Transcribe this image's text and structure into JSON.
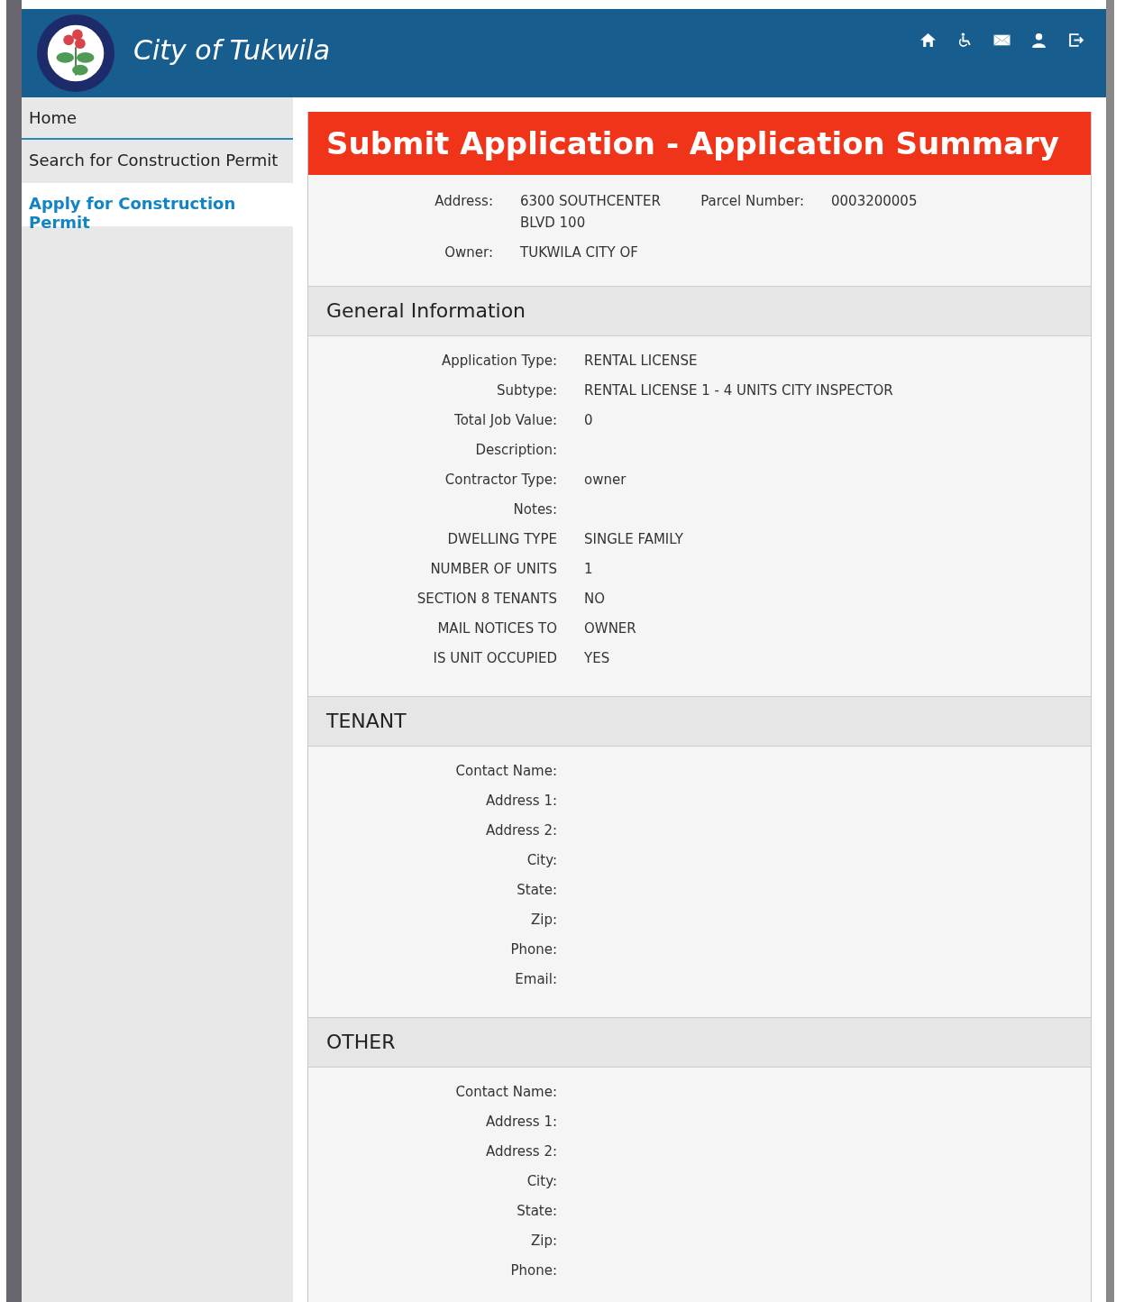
{
  "header": {
    "title": "City of Tukwila"
  },
  "sidebar": {
    "items": [
      {
        "label": "Home",
        "selected": false
      },
      {
        "label": "Search for Construction Permit",
        "selected": false
      },
      {
        "label": "Apply for Construction Permit",
        "selected": true
      }
    ]
  },
  "page_title": "Submit Application - Application Summary",
  "summary": {
    "address_label": "Address:",
    "address": "6300 SOUTHCENTER BLVD 100",
    "parcel_label": "Parcel Number:",
    "parcel": "0003200005",
    "owner_label": "Owner:",
    "owner": "TUKWILA CITY OF"
  },
  "sections": [
    {
      "title": "General Information",
      "fields": [
        {
          "label": "Application Type:",
          "value": "RENTAL LICENSE"
        },
        {
          "label": "Subtype:",
          "value": "RENTAL LICENSE 1 - 4 UNITS CITY INSPECTOR"
        },
        {
          "label": "Total Job Value:",
          "value": "0"
        },
        {
          "label": "Description:"
        },
        {
          "label": "Contractor Type:",
          "value": "owner"
        },
        {
          "label": "Notes:"
        },
        {
          "label": "DWELLING TYPE",
          "value": "SINGLE FAMILY"
        },
        {
          "label": "NUMBER OF UNITS",
          "value": "1"
        },
        {
          "label": "SECTION 8 TENANTS",
          "value": "NO"
        },
        {
          "label": "MAIL NOTICES TO",
          "value": "OWNER"
        },
        {
          "label": "IS UNIT OCCUPIED",
          "value": "YES"
        }
      ]
    },
    {
      "title": "TENANT",
      "fields": [
        {
          "label": "Contact Name:"
        },
        {
          "label": "Address 1:"
        },
        {
          "label": "Address 2:"
        },
        {
          "label": "City:"
        },
        {
          "label": "State:"
        },
        {
          "label": "Zip:"
        },
        {
          "label": "Phone:"
        },
        {
          "label": "Email:"
        }
      ]
    },
    {
      "title": "OTHER",
      "fields": [
        {
          "label": "Contact Name:"
        },
        {
          "label": "Address 1:"
        },
        {
          "label": "Address 2:"
        },
        {
          "label": "City:"
        },
        {
          "label": "State:"
        },
        {
          "label": "Zip:"
        },
        {
          "label": "Phone:"
        }
      ]
    }
  ]
}
